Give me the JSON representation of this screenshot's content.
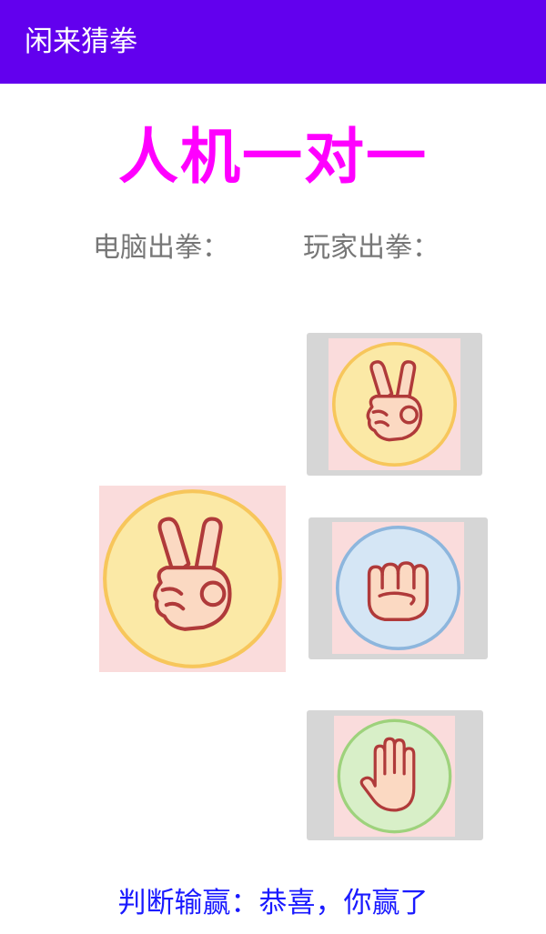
{
  "app": {
    "title": "闲来猜拳"
  },
  "header": {
    "title": "人机一对一"
  },
  "labels": {
    "computer": "电脑出拳：",
    "player": "玩家出拳："
  },
  "computer_choice": {
    "gesture": "scissors-icon"
  },
  "player_choices": [
    {
      "gesture": "scissors-icon",
      "circle_color": "#fbe9a6",
      "ring_color": "#f7c65b"
    },
    {
      "gesture": "rock-icon",
      "circle_color": "#d5e6f5",
      "ring_color": "#8db6dd"
    },
    {
      "gesture": "paper-icon",
      "circle_color": "#d8efc8",
      "ring_color": "#9ed27c"
    }
  ],
  "result": {
    "text": "判断输赢：恭喜，你赢了"
  },
  "colors": {
    "app_bar": "#6200ee",
    "title": "#ff00ff",
    "result": "#1a1aff",
    "skin": "#fbd9c2",
    "outline": "#b03a3a"
  }
}
